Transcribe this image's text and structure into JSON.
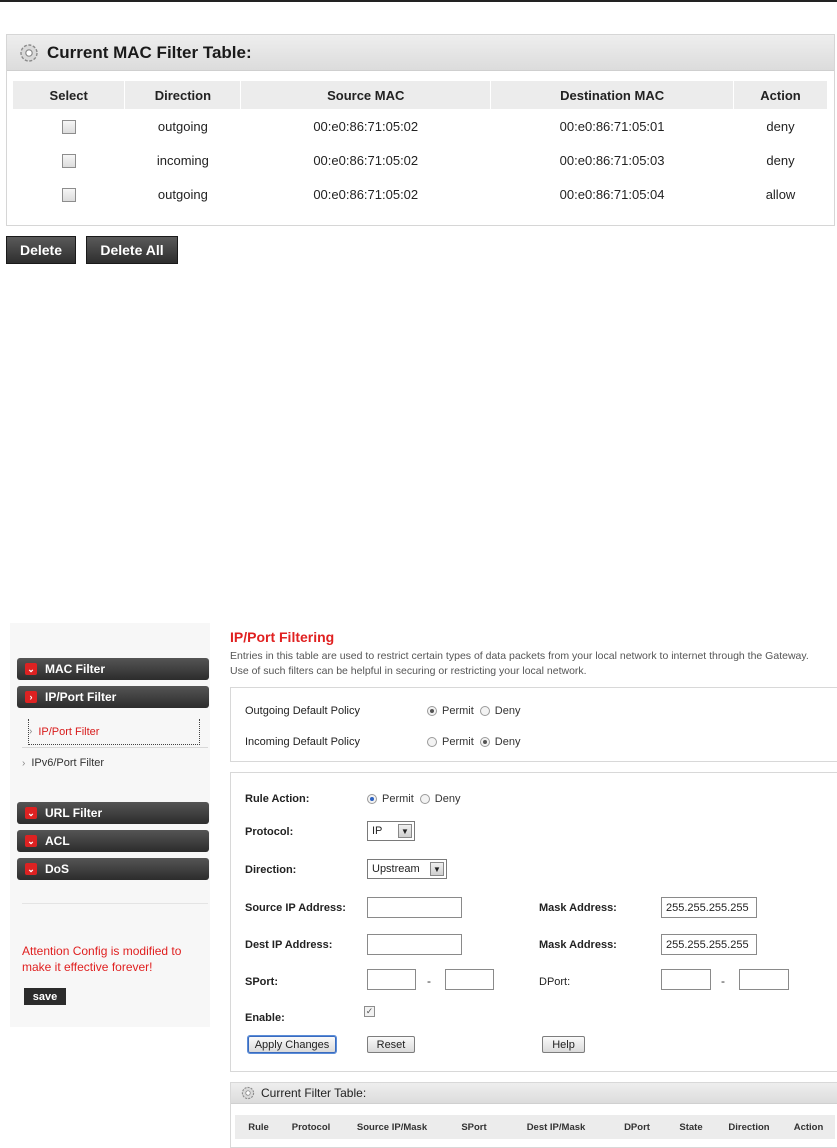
{
  "mac_filter": {
    "title": "Current MAC Filter Table:",
    "icon": "gear-icon",
    "columns": [
      "Select",
      "Direction",
      "Source MAC",
      "Destination MAC",
      "Action"
    ],
    "rows": [
      {
        "direction": "outgoing",
        "source": "00:e0:86:71:05:02",
        "dest": "00:e0:86:71:05:01",
        "action": "deny"
      },
      {
        "direction": "incoming",
        "source": "00:e0:86:71:05:02",
        "dest": "00:e0:86:71:05:03",
        "action": "deny"
      },
      {
        "direction": "outgoing",
        "source": "00:e0:86:71:05:02",
        "dest": "00:e0:86:71:05:04",
        "action": "allow"
      }
    ],
    "delete_label": "Delete",
    "delete_all_label": "Delete All"
  },
  "sidebar": {
    "items": [
      {
        "label": "MAC Filter"
      },
      {
        "label": "IP/Port Filter"
      },
      {
        "label": "URL Filter"
      },
      {
        "label": "ACL"
      },
      {
        "label": "DoS"
      }
    ],
    "subitems": [
      {
        "label": "IP/Port Filter"
      },
      {
        "label": "IPv6/Port Filter"
      }
    ],
    "attention": "Attention Config is modified to make it effective forever!",
    "save_label": "save"
  },
  "main": {
    "title": "IP/Port Filtering",
    "description": "Entries in this table are used to restrict certain types of data packets from your local network to internet through the Gateway. Use of such filters can be helpful in securing or restricting your local network.",
    "outgoing_policy_label": "Outgoing Default Policy",
    "incoming_policy_label": "Incoming Default Policy",
    "permit_label": "Permit",
    "deny_label": "Deny",
    "outgoing_policy": "Permit",
    "incoming_policy": "Deny",
    "rule_action_label": "Rule Action:",
    "rule_action": "Permit",
    "protocol_label": "Protocol:",
    "protocol_value": "IP",
    "direction_label": "Direction:",
    "direction_value": "Upstream",
    "source_ip_label": "Source IP Address:",
    "dest_ip_label": "Dest IP Address:",
    "mask_label": "Mask Address:",
    "source_mask": "255.255.255.255",
    "dest_mask": "255.255.255.255",
    "sport_label": "SPort:",
    "dport_label": "DPort:",
    "range_sep": "-",
    "enable_label": "Enable:",
    "enable_checked": true,
    "apply_label": "Apply Changes",
    "reset_label": "Reset",
    "help_label": "Help"
  },
  "filter_table": {
    "title": "Current Filter Table:",
    "columns": [
      "Rule",
      "Protocol",
      "Source IP/Mask",
      "SPort",
      "Dest IP/Mask",
      "DPort",
      "State",
      "Direction",
      "Action"
    ]
  },
  "colors": {
    "accent_red": "#e02020",
    "dark_button": "#2e2e2e"
  }
}
